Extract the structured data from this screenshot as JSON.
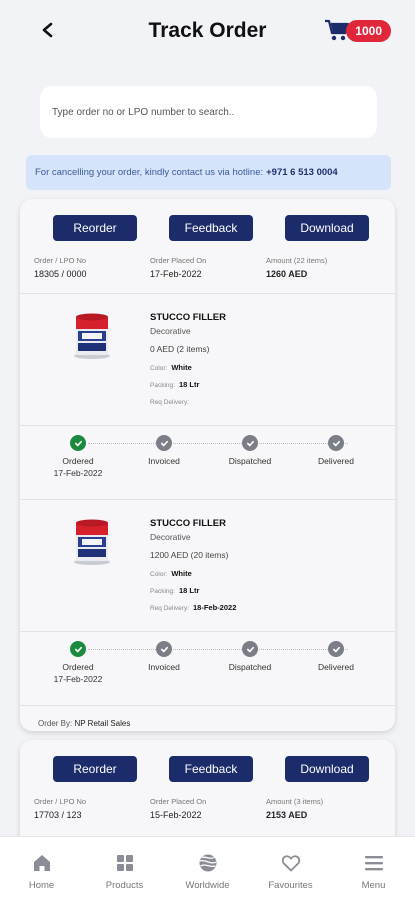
{
  "header": {
    "title": "Track Order",
    "back_icon": "arrow-left-icon",
    "cart_icon": "cart-icon",
    "cart_badge": "1000"
  },
  "search": {
    "placeholder": "Type order no or LPO number to search.."
  },
  "notice": {
    "text": "For cancelling your order, kindly contact us via hotline:",
    "hotline": "+971 6 513 0004"
  },
  "colors": {
    "primary": "#1c2c6b",
    "done": "#1b8a3f",
    "pending": "#7b7e86",
    "badge": "#e0273a",
    "notice_bg": "#d5e4fb"
  },
  "orders": [
    {
      "buttons": {
        "reorder": "Reorder",
        "feedback": "Feedback",
        "download": "Download"
      },
      "meta": {
        "lpo_label": "Order / LPO No",
        "lpo_value": "18305 / 0000",
        "placed_label": "Order Placed On",
        "placed_value": "17-Feb-2022",
        "amount_label": "Amount (22 items)",
        "amount_value": "1260 AED"
      },
      "items": [
        {
          "name": "STUCCO FILLER",
          "category": "Decorative",
          "price": "0 AED (2 items)",
          "color_label": "Color:",
          "color_value": "White",
          "packing_label": "Packing:",
          "packing_value": "18 Ltr",
          "delivery_label": "Req Delivery:",
          "delivery_value": "",
          "steps": [
            {
              "label": "Ordered",
              "date": "17-Feb-2022",
              "status": "done"
            },
            {
              "label": "Invoiced",
              "date": "",
              "status": "pending"
            },
            {
              "label": "Dispatched",
              "date": "",
              "status": "pending"
            },
            {
              "label": "Delivered",
              "date": "",
              "status": "pending"
            }
          ]
        },
        {
          "name": "STUCCO FILLER",
          "category": "Decorative",
          "price": "1200 AED (20 items)",
          "color_label": "Color:",
          "color_value": "White",
          "packing_label": "Packing:",
          "packing_value": "18 Ltr",
          "delivery_label": "Req Delivery:",
          "delivery_value": "18-Feb-2022",
          "steps": [
            {
              "label": "Ordered",
              "date": "17-Feb-2022",
              "status": "done"
            },
            {
              "label": "Invoiced",
              "date": "",
              "status": "pending"
            },
            {
              "label": "Dispatched",
              "date": "",
              "status": "pending"
            },
            {
              "label": "Delivered",
              "date": "",
              "status": "pending"
            }
          ]
        }
      ],
      "order_by_label": "Order By:",
      "order_by_value": "NP Retail Sales"
    },
    {
      "buttons": {
        "reorder": "Reorder",
        "feedback": "Feedback",
        "download": "Download"
      },
      "meta": {
        "lpo_label": "Order / LPO No",
        "lpo_value": "17703 / 123",
        "placed_label": "Order Placed On",
        "placed_value": "15-Feb-2022",
        "amount_label": "Amount (3 items)",
        "amount_value": "2153 AED"
      }
    }
  ],
  "bottom_nav": [
    {
      "label": "Home",
      "icon": "home-icon"
    },
    {
      "label": "Products",
      "icon": "grid-icon"
    },
    {
      "label": "Worldwide",
      "icon": "globe-icon"
    },
    {
      "label": "Favourites",
      "icon": "heart-icon"
    },
    {
      "label": "Menu",
      "icon": "menu-icon"
    }
  ]
}
